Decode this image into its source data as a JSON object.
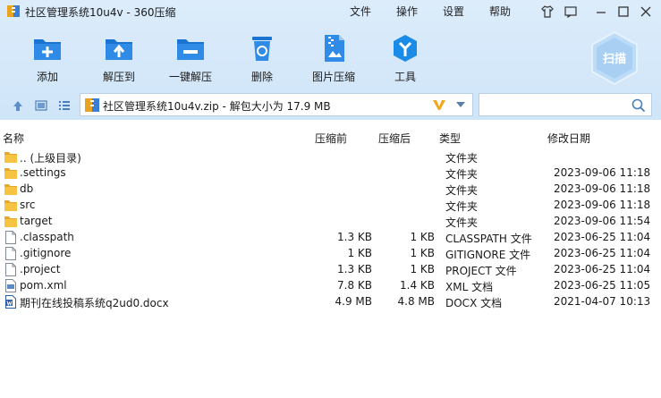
{
  "window": {
    "title": "社区管理系统10u4v - 360压缩",
    "menu": [
      "文件",
      "操作",
      "设置",
      "帮助"
    ]
  },
  "toolbar": {
    "buttons": [
      {
        "label": "添加",
        "icon": "add-icon"
      },
      {
        "label": "解压到",
        "icon": "extract-to-icon"
      },
      {
        "label": "一键解压",
        "icon": "one-click-extract-icon"
      },
      {
        "label": "删除",
        "icon": "delete-icon"
      },
      {
        "label": "图片压缩",
        "icon": "image-compress-icon"
      },
      {
        "label": "工具",
        "icon": "tools-icon"
      }
    ],
    "scan_label": "扫描"
  },
  "address": {
    "path": "社区管理系统10u4v.zip - 解包大小为 17.9 MB"
  },
  "search": {
    "placeholder": ""
  },
  "columns": {
    "name": "名称",
    "compressed": "压缩前",
    "uncompressed": "压缩后",
    "type": "类型",
    "modified": "修改日期"
  },
  "files": [
    {
      "name": ".. (上级目录)",
      "before": "",
      "after": "",
      "type": "文件夹",
      "date": "",
      "kind": "folder"
    },
    {
      "name": ".settings",
      "before": "",
      "after": "",
      "type": "文件夹",
      "date": "2023-09-06 11:18",
      "kind": "folder"
    },
    {
      "name": "db",
      "before": "",
      "after": "",
      "type": "文件夹",
      "date": "2023-09-06 11:18",
      "kind": "folder"
    },
    {
      "name": "src",
      "before": "",
      "after": "",
      "type": "文件夹",
      "date": "2023-09-06 11:18",
      "kind": "folder"
    },
    {
      "name": "target",
      "before": "",
      "after": "",
      "type": "文件夹",
      "date": "2023-09-06 11:54",
      "kind": "folder"
    },
    {
      "name": ".classpath",
      "before": "1.3 KB",
      "after": "1 KB",
      "type": "CLASSPATH 文件",
      "date": "2023-06-25 11:04",
      "kind": "file"
    },
    {
      "name": ".gitignore",
      "before": "1 KB",
      "after": "1 KB",
      "type": "GITIGNORE 文件",
      "date": "2023-06-25 11:04",
      "kind": "file"
    },
    {
      "name": ".project",
      "before": "1.3 KB",
      "after": "1 KB",
      "type": "PROJECT 文件",
      "date": "2023-06-25 11:04",
      "kind": "file"
    },
    {
      "name": "pom.xml",
      "before": "7.8 KB",
      "after": "1.4 KB",
      "type": "XML 文档",
      "date": "2023-06-25 11:05",
      "kind": "xml"
    },
    {
      "name": "期刊在线投稿系统q2ud0.docx",
      "before": "4.9 MB",
      "after": "4.8 MB",
      "type": "DOCX 文档",
      "date": "2021-04-07 10:13",
      "kind": "docx"
    }
  ]
}
